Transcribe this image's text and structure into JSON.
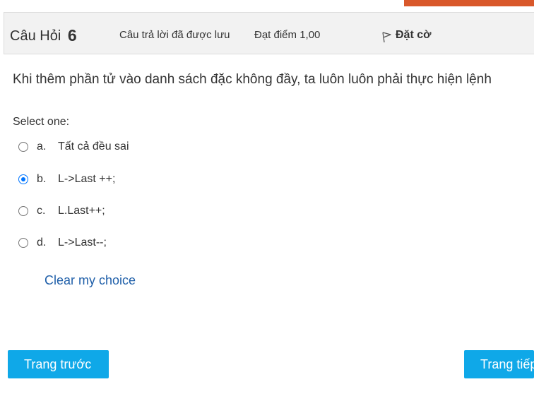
{
  "question": {
    "title_prefix": "Câu Hỏi",
    "number": "6",
    "state": "Câu trả lời đã được lưu",
    "grade": "Đạt điểm 1,00",
    "flag_label": "Đặt cờ",
    "text": "Khi thêm phần tử vào danh sách đặc không đầy, ta luôn luôn phải thực hiện lệnh",
    "prompt": "Select one:",
    "options": [
      {
        "letter": "a.",
        "text": "Tất cả đều sai",
        "selected": false
      },
      {
        "letter": "b.",
        "text": "L->Last ++;",
        "selected": true
      },
      {
        "letter": "c.",
        "text": "L.Last++;",
        "selected": false
      },
      {
        "letter": "d.",
        "text": "L->Last--;",
        "selected": false
      }
    ],
    "clear_label": "Clear my choice"
  },
  "navigation": {
    "prev_label": "Trang trước",
    "next_label": "Trang tiếp"
  },
  "colors": {
    "accent": "#d9582b",
    "button": "#0fa8e8",
    "link": "#1f5fa9",
    "radio_checked": "#0075ff"
  },
  "icons": {
    "flag": "flag-icon"
  }
}
